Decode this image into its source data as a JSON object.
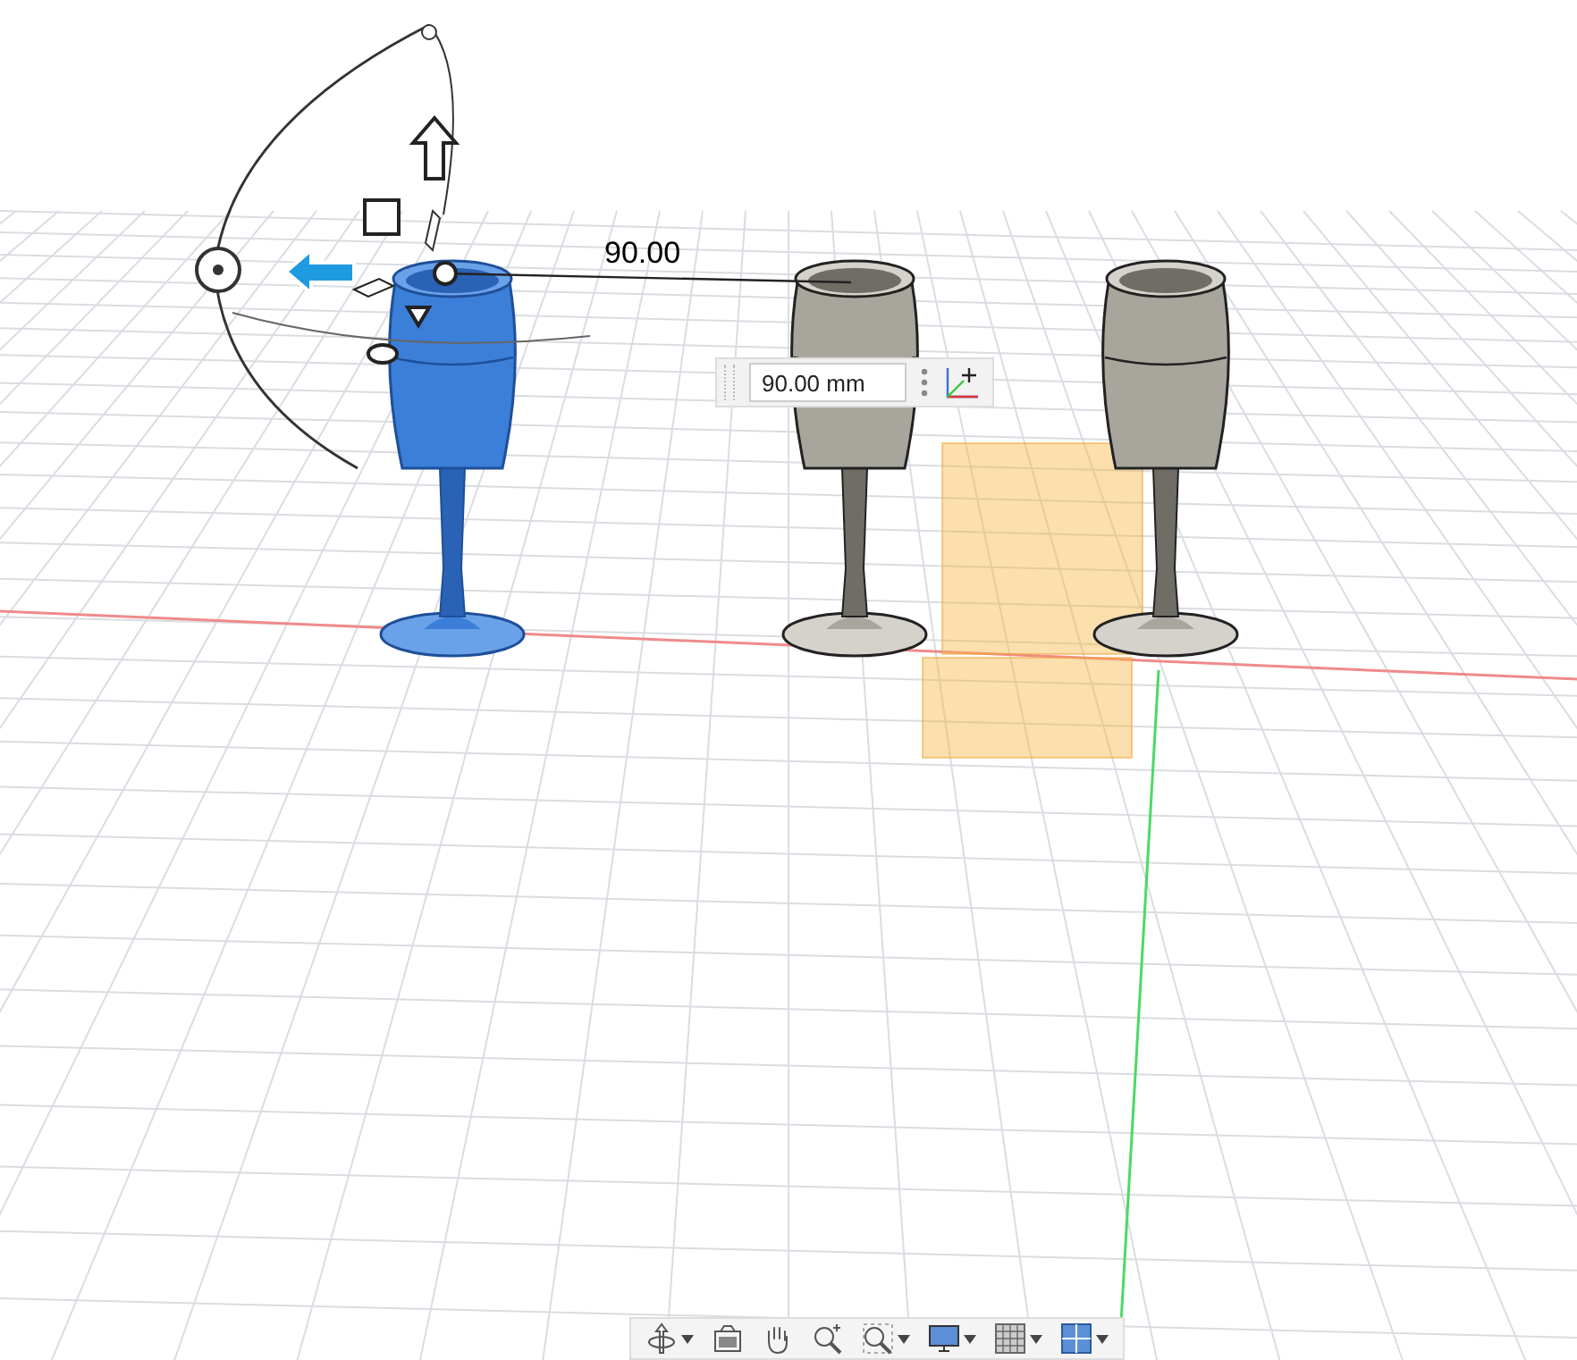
{
  "dimension_label": "90.00",
  "distance_input": {
    "value": "90.00 mm"
  },
  "bodies": [
    {
      "selected": true
    },
    {
      "selected": false
    },
    {
      "selected": false
    }
  ],
  "toolbar": {
    "items": [
      {
        "kind": "orbit",
        "has_menu": true
      },
      {
        "kind": "look_at",
        "has_menu": false
      },
      {
        "kind": "pan",
        "has_menu": false
      },
      {
        "kind": "zoom",
        "has_menu": false
      },
      {
        "kind": "fit",
        "has_menu": true
      },
      {
        "kind": "display",
        "has_menu": true
      },
      {
        "kind": "grid",
        "has_menu": true
      },
      {
        "kind": "viewports",
        "has_menu": true
      }
    ]
  }
}
